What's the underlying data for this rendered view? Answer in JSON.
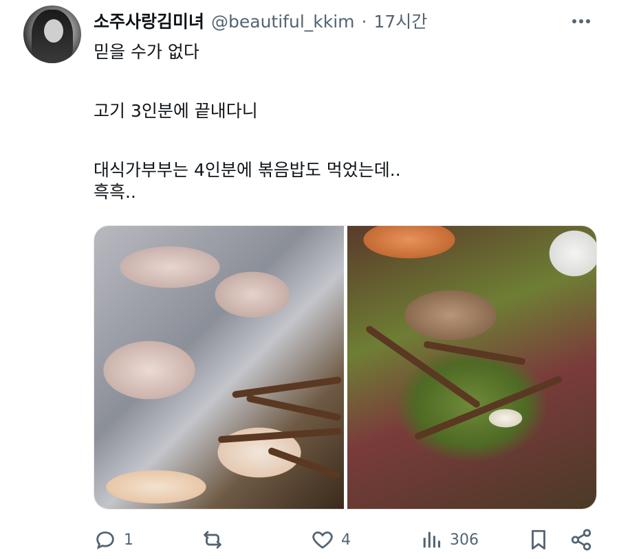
{
  "tweet": {
    "display_name": "소주사랑김미녀",
    "handle": "@beautiful_kkim",
    "separator": "·",
    "time": "17시간",
    "text_lines": {
      "l1": "믿을 수가 없다",
      "l2": "고기 3인분에 끝내다니",
      "l3": "대식가부부는 4인분에 볶음밥도 먹었는데..",
      "l4": "흑흑.."
    }
  },
  "actions": {
    "reply_count": "1",
    "retweet_count": "",
    "like_count": "4",
    "views_count": "306"
  },
  "icons": {
    "more": "more-horizontal-icon",
    "reply": "reply-icon",
    "retweet": "retweet-icon",
    "like": "heart-icon",
    "views": "views-icon",
    "bookmark": "bookmark-icon",
    "share": "share-icon"
  },
  "colors": {
    "text": "#0f1419",
    "secondary": "#536471"
  }
}
